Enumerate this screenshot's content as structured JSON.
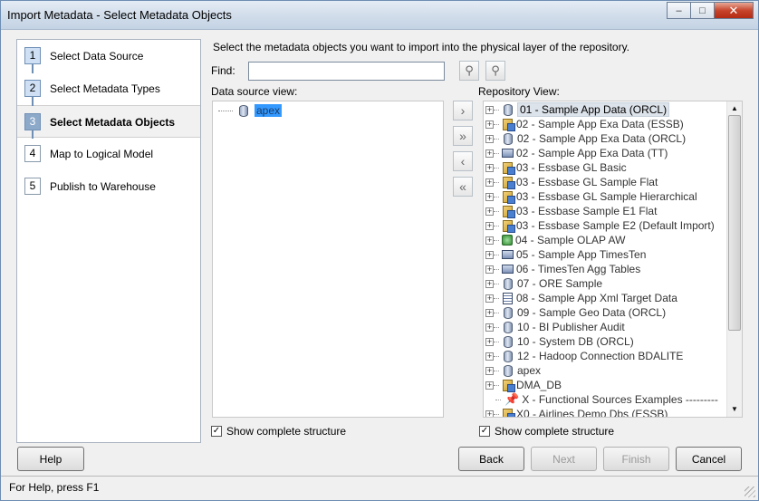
{
  "window": {
    "title": "Import Metadata - Select Metadata Objects",
    "controls": {
      "minimize": "–",
      "maximize": "□",
      "close": "✕"
    }
  },
  "steps": [
    {
      "num": "1",
      "label": "Select Data Source",
      "state": "done"
    },
    {
      "num": "2",
      "label": "Select Metadata Types",
      "state": "done"
    },
    {
      "num": "3",
      "label": "Select Metadata Objects",
      "state": "active"
    },
    {
      "num": "4",
      "label": "Map to Logical Model",
      "state": "pending"
    },
    {
      "num": "5",
      "label": "Publish to Warehouse",
      "state": "pending"
    }
  ],
  "main": {
    "instruction": "Select the metadata objects you want to import into the physical layer of the repository.",
    "find_label": "Find:",
    "find_value": "",
    "data_source_view_label": "Data source view:",
    "repository_view_label": "Repository View:",
    "data_source_item": "apex",
    "show_structure_label": "Show complete structure"
  },
  "repository": [
    {
      "label": "01 - Sample App Data (ORCL)",
      "icon": "database",
      "selected": true
    },
    {
      "label": "02 - Sample App Exa Data (ESSB)",
      "icon": "cube"
    },
    {
      "label": "02 - Sample App Exa Data (ORCL)",
      "icon": "database"
    },
    {
      "label": "02 - Sample App Exa Data (TT)",
      "icon": "timesten"
    },
    {
      "label": "03 - Essbase GL Basic",
      "icon": "cube"
    },
    {
      "label": "03 - Essbase GL Sample Flat",
      "icon": "cube"
    },
    {
      "label": "03 - Essbase GL Sample Hierarchical",
      "icon": "cube"
    },
    {
      "label": "03 - Essbase Sample E1 Flat",
      "icon": "cube"
    },
    {
      "label": "03 - Essbase Sample E2 (Default Import)",
      "icon": "cube"
    },
    {
      "label": "04 - Sample OLAP AW",
      "icon": "olap"
    },
    {
      "label": "05 - Sample App TimesTen",
      "icon": "timesten"
    },
    {
      "label": "06 - TimesTen Agg Tables",
      "icon": "timesten"
    },
    {
      "label": "07 - ORE Sample",
      "icon": "database"
    },
    {
      "label": "08 - Sample App Xml Target Data",
      "icon": "xml"
    },
    {
      "label": "09 - Sample Geo Data (ORCL)",
      "icon": "database"
    },
    {
      "label": "10 - BI Publisher Audit",
      "icon": "database"
    },
    {
      "label": "10 - System DB (ORCL)",
      "icon": "database"
    },
    {
      "label": "12 - Hadoop Connection BDALITE",
      "icon": "database"
    },
    {
      "label": "apex",
      "icon": "database"
    },
    {
      "label": "DMA_DB",
      "icon": "cube"
    },
    {
      "label": "X - Functional Sources Examples ---------",
      "icon": "pin",
      "no_expander": true
    },
    {
      "label": "X0 - Airlines Demo Dbs (ESSB)",
      "icon": "cube"
    }
  ],
  "buttons": {
    "help": "Help",
    "back": "Back",
    "next": "Next",
    "finish": "Finish",
    "cancel": "Cancel"
  },
  "status": "For Help, press F1"
}
